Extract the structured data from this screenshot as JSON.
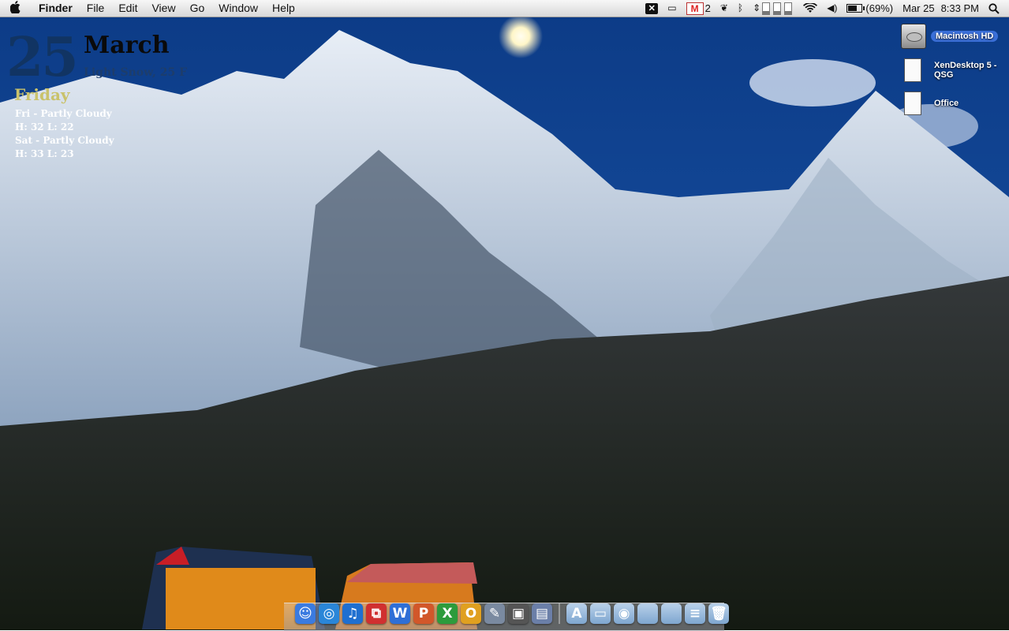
{
  "menubar": {
    "apple_icon": "apple-icon",
    "app_name": "Finder",
    "menus": [
      "File",
      "Edit",
      "View",
      "Go",
      "Window",
      "Help"
    ],
    "mail_count": "2",
    "battery": "(69%)",
    "date": "Mar 25",
    "time": "8:33 PM"
  },
  "weather_widget": {
    "day_number": "25",
    "month": "March",
    "condition": "Light Snow, 25 F",
    "weekday": "Friday",
    "forecast": [
      {
        "summary": "Fri - Partly Cloudy",
        "temps": "H: 32 L: 22"
      },
      {
        "summary": "Sat - Partly Cloudy",
        "temps": "H: 33 L: 23"
      }
    ]
  },
  "desktop_icons": [
    {
      "label": "Macintosh HD",
      "icon": "hard-drive-icon",
      "selected": true
    },
    {
      "label": "XenDesktop 5 - QSG",
      "icon": "document-icon"
    },
    {
      "label": "Office",
      "icon": "document-icon"
    }
  ],
  "dock": {
    "apps": [
      {
        "name": "Finder",
        "icon": "finder-icon",
        "glyph": "☺",
        "color": "#3b7be0"
      },
      {
        "name": "Safari",
        "icon": "safari-icon",
        "glyph": "◎",
        "color": "#2a86d8"
      },
      {
        "name": "iTunes",
        "icon": "itunes-icon",
        "glyph": "♫",
        "color": "#1f6fd0"
      },
      {
        "name": "Parallels",
        "icon": "parallels-icon",
        "glyph": "⧉",
        "color": "#d03030"
      },
      {
        "name": "Word",
        "icon": "word-icon",
        "glyph": "W",
        "color": "#2f6fd6"
      },
      {
        "name": "PowerPoint",
        "icon": "powerpoint-icon",
        "glyph": "P",
        "color": "#d2572a"
      },
      {
        "name": "Excel",
        "icon": "excel-icon",
        "glyph": "X",
        "color": "#2d9b3c"
      },
      {
        "name": "Outlook",
        "icon": "outlook-icon",
        "glyph": "O",
        "color": "#e0a020"
      },
      {
        "name": "Preview",
        "icon": "preview-icon",
        "glyph": "✎",
        "color": "#7a8aa0"
      },
      {
        "name": "Screen Sharing",
        "icon": "screen-sharing-icon",
        "glyph": "▣",
        "color": "#555"
      },
      {
        "name": "iPhoto",
        "icon": "iphoto-icon",
        "glyph": "▤",
        "color": "#6b7fa8"
      }
    ],
    "stacks": [
      {
        "name": "Applications",
        "icon": "applications-folder-icon",
        "glyph": "A"
      },
      {
        "name": "Documents",
        "icon": "documents-folder-icon",
        "glyph": "▭"
      },
      {
        "name": "Downloads",
        "icon": "downloads-folder-icon",
        "glyph": "◉"
      },
      {
        "name": "Folder",
        "icon": "folder-icon",
        "glyph": ""
      },
      {
        "name": "Folder",
        "icon": "folder-icon",
        "glyph": ""
      },
      {
        "name": "Document Stack",
        "icon": "document-stack-icon",
        "glyph": "≡"
      },
      {
        "name": "Trash",
        "icon": "trash-icon",
        "glyph": "🗑"
      }
    ]
  }
}
